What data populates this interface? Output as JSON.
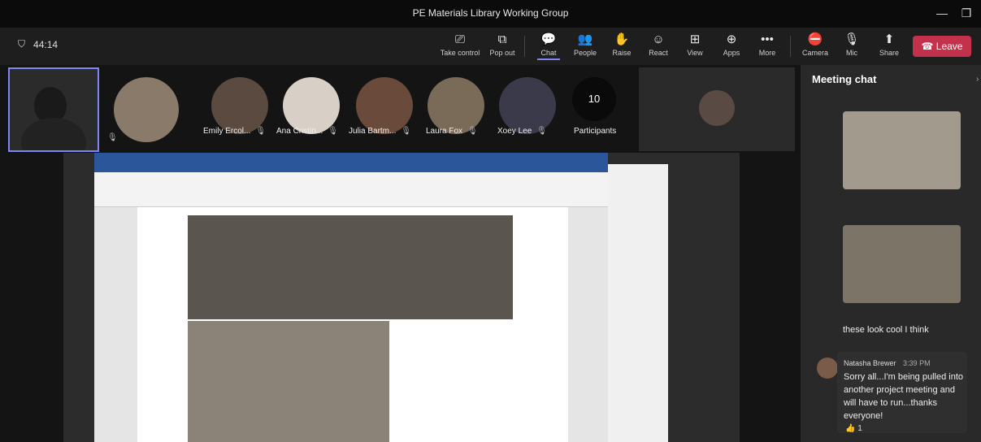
{
  "window": {
    "title": "PE Materials Library Working Group"
  },
  "timer": "44:14",
  "toolbar": {
    "take_control": "Take control",
    "pop_out": "Pop out",
    "chat": "Chat",
    "people": "People",
    "raise": "Raise",
    "react": "React",
    "view": "View",
    "apps": "Apps",
    "more": "More",
    "camera": "Camera",
    "mic": "Mic",
    "share": "Share",
    "leave": "Leave"
  },
  "participants": [
    {
      "name": "Emily Ercol..."
    },
    {
      "name": "Ana Cristin..."
    },
    {
      "name": "Julia Bartm..."
    },
    {
      "name": "Laura Fox"
    },
    {
      "name": "Xoey Lee"
    }
  ],
  "participant_count": {
    "count": "10",
    "label": "Participants"
  },
  "chat": {
    "title": "Meeting chat",
    "previous_message": "these look cool I think",
    "sender": "Natasha Brewer",
    "time": "3:39 PM",
    "message": "Sorry all...I'm being pulled into another project meeting and will have to run...thanks everyone!",
    "reaction_count": "1"
  },
  "colors": {
    "accent": "#7f85f5",
    "leave": "#c4314b",
    "word": "#2b579a"
  }
}
